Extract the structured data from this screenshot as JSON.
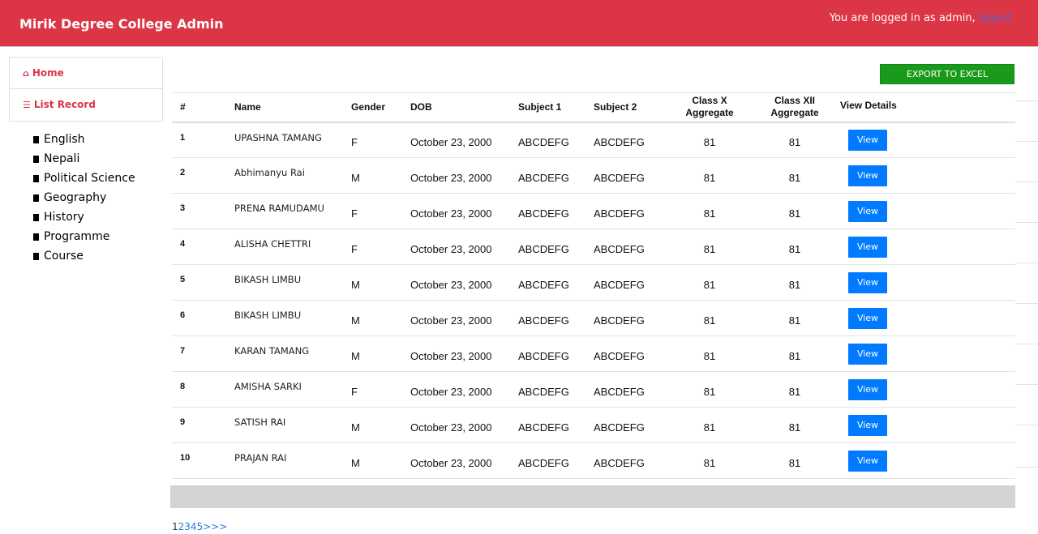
{
  "header": {
    "brand": "Mirik Degree College Admin",
    "logged_in_text": "You are logged in as admin, ",
    "logout_label": "logout"
  },
  "sidebar": {
    "home_label": "Home",
    "home_icon": "home-icon",
    "list_label": "List Record",
    "list_icon": "list-icon",
    "subjects": [
      "English",
      "Nepali",
      "Political Science",
      "Geography",
      "History",
      "Programme",
      "Course"
    ]
  },
  "toolbar": {
    "export_label": "EXPORT TO EXCEL"
  },
  "table": {
    "headers": {
      "idx": "#",
      "name": "Name",
      "gender": "Gender",
      "dob": "DOB",
      "subject1": "Subject 1",
      "subject2": "Subject 2",
      "classx_line1": "Class X",
      "classx_line2": "Aggregate",
      "classxii_line1": "Class XII",
      "classxii_line2": "Aggregate",
      "view": "View Details"
    },
    "view_label": "View",
    "rows": [
      {
        "idx": "1",
        "name": "UPASHNA TAMANG",
        "gender": "F",
        "dob": "October 23, 2000",
        "s1": "ABCDEFG",
        "s2": "ABCDEFG",
        "x": "81",
        "xii": "81"
      },
      {
        "idx": "2",
        "name": "Abhimanyu Rai",
        "gender": "M",
        "dob": "October 23, 2000",
        "s1": "ABCDEFG",
        "s2": "ABCDEFG",
        "x": "81",
        "xii": "81"
      },
      {
        "idx": "3",
        "name": "PRENA RAMUDAMU",
        "gender": "F",
        "dob": "October 23, 2000",
        "s1": "ABCDEFG",
        "s2": "ABCDEFG",
        "x": "81",
        "xii": "81"
      },
      {
        "idx": "4",
        "name": "ALISHA CHETTRI",
        "gender": "F",
        "dob": "October 23, 2000",
        "s1": "ABCDEFG",
        "s2": "ABCDEFG",
        "x": "81",
        "xii": "81"
      },
      {
        "idx": "5",
        "name": "BIKASH LIMBU",
        "gender": "M",
        "dob": "October 23, 2000",
        "s1": "ABCDEFG",
        "s2": "ABCDEFG",
        "x": "81",
        "xii": "81"
      },
      {
        "idx": "6",
        "name": "BIKASH LIMBU",
        "gender": "M",
        "dob": "October 23, 2000",
        "s1": "ABCDEFG",
        "s2": "ABCDEFG",
        "x": "81",
        "xii": "81"
      },
      {
        "idx": "7",
        "name": "KARAN TAMANG",
        "gender": "M",
        "dob": "October 23, 2000",
        "s1": "ABCDEFG",
        "s2": "ABCDEFG",
        "x": "81",
        "xii": "81"
      },
      {
        "idx": "8",
        "name": "AMISHA SARKI",
        "gender": "F",
        "dob": "October 23, 2000",
        "s1": "ABCDEFG",
        "s2": "ABCDEFG",
        "x": "81",
        "xii": "81"
      },
      {
        "idx": "9",
        "name": "SATISH RAI",
        "gender": "M",
        "dob": "October 23, 2000",
        "s1": "ABCDEFG",
        "s2": "ABCDEFG",
        "x": "81",
        "xii": "81"
      },
      {
        "idx": "10",
        "name": "PRAJAN RAI",
        "gender": "M",
        "dob": "October 23, 2000",
        "s1": "ABCDEFG",
        "s2": "ABCDEFG",
        "x": "81",
        "xii": "81"
      }
    ]
  },
  "pagination": {
    "current": "1",
    "pages": [
      "2",
      "3",
      "4",
      "5"
    ],
    "next": ">>>"
  },
  "colors": {
    "header_bg": "#dc3545",
    "export_bg": "#1a9a1a",
    "view_bg": "#007bff",
    "footer_bar": "#d3d3d3"
  }
}
